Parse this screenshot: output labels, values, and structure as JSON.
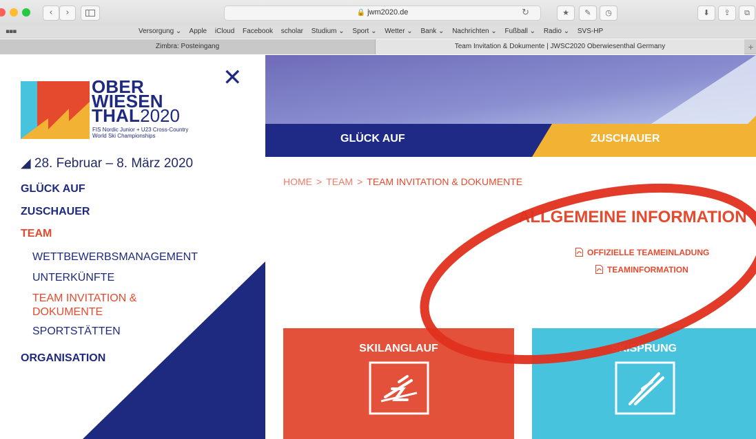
{
  "browser": {
    "url": "jwm2020.de",
    "back_icon": "‹",
    "forward_icon": "›",
    "bookmarks": [
      "Versorgung ⌄",
      "Apple",
      "iCloud",
      "Facebook",
      "scholar",
      "Studium ⌄",
      "Sport ⌄",
      "Wetter ⌄",
      "Bank ⌄",
      "Nachrichten ⌄",
      "Fußball ⌄",
      "Radio ⌄",
      "SVS-HP"
    ],
    "tabs": [
      {
        "label": "Zimbra: Posteingang"
      },
      {
        "label": "Team Invitation & Dokumente | JWSC2020 Oberwiesenthal Germany"
      }
    ],
    "new_tab": "+"
  },
  "menu": {
    "logo": {
      "line1": "OBER",
      "line2": "WIESEN",
      "line3_bold": "THAL",
      "line3_year": "2020",
      "sub1": "FIS Nordic Junior + U23 Cross-Country",
      "sub2": "World Ski Championships"
    },
    "close": "✕",
    "date": "◢ 28. Februar – 8. März 2020",
    "items": [
      {
        "label": "GLÜCK AUF"
      },
      {
        "label": "ZUSCHAUER"
      },
      {
        "label": "TEAM"
      },
      {
        "label": "ORGANISATION"
      }
    ],
    "team_sub": [
      {
        "label": "WETTBEWERBSMANAGEMENT"
      },
      {
        "label": "UNTERKÜNFTE"
      },
      {
        "label": "TEAM INVITATION & DOKUMENTE"
      },
      {
        "label": "SPORTSTÄTTEN"
      }
    ]
  },
  "header_nav": {
    "item1": "GLÜCK AUF",
    "item2": "ZUSCHAUER"
  },
  "breadcrumb": {
    "home": "HOME",
    "team": "TEAM",
    "current": "TEAM INVITATION & DOKUMENTE",
    "separator": ">"
  },
  "section": {
    "title": "ALLGEMEINE INFORMATION",
    "links": [
      {
        "label": "OFFIZIELLE TEAMEINLADUNG"
      },
      {
        "label": "TEAMINFORMATION"
      }
    ]
  },
  "tiles": [
    {
      "label": "SKILANGLAUF",
      "color": "#e4513a"
    },
    {
      "label": "SKISPRUNG",
      "color": "#48c3de"
    }
  ],
  "colors": {
    "navy": "#1e2a80",
    "accent_red": "#e64a2e",
    "gold": "#f2b233",
    "annotation": "#e0301e"
  }
}
